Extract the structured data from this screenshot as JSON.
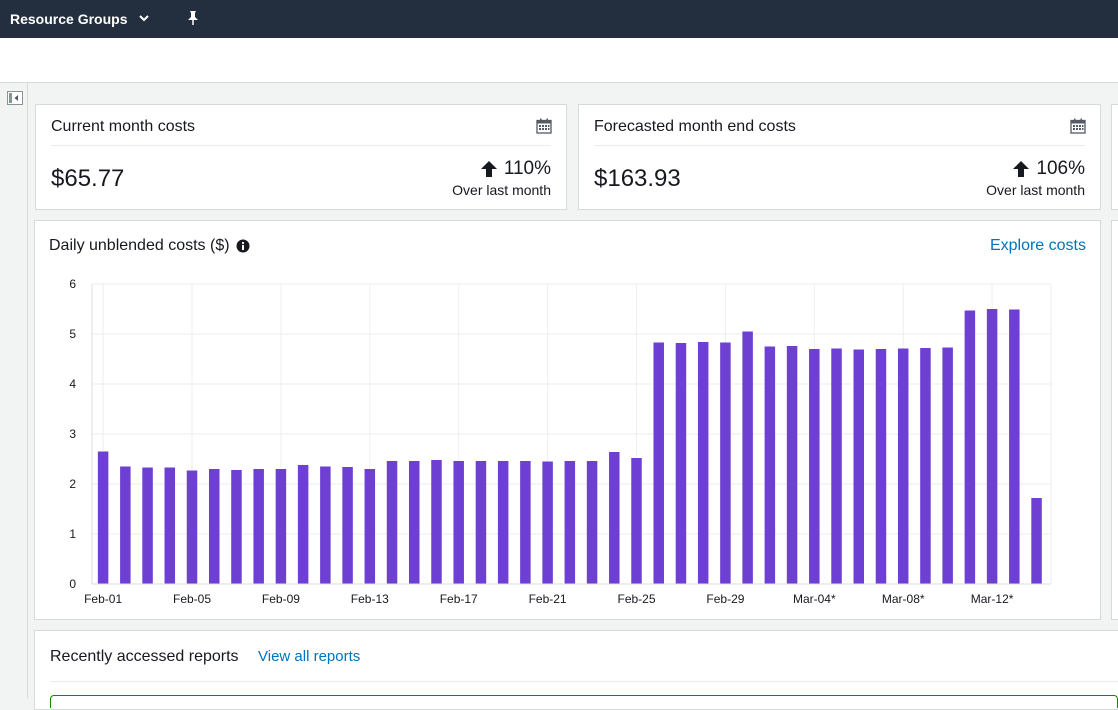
{
  "header": {
    "resource_groups_label": "Resource Groups",
    "icons": [
      "chevron-down-icon",
      "pin-icon"
    ],
    "bg_color": "#232f3e"
  },
  "cards": {
    "current": {
      "title": "Current month costs",
      "value": "$65.77",
      "change": "110%",
      "change_sub": "Over last month",
      "icon": "calendar-icon"
    },
    "forecast": {
      "title": "Forecasted month end costs",
      "value": "$163.93",
      "change": "106%",
      "change_sub": "Over last month",
      "icon": "calendar-icon"
    }
  },
  "daily_chart": {
    "title": "Daily unblended costs ($)",
    "explore_label": "Explore costs",
    "info_icon": "info-icon"
  },
  "chart_data": {
    "type": "bar",
    "title": "Daily unblended costs ($)",
    "xlabel": "",
    "ylabel": "",
    "ylim": [
      0,
      6
    ],
    "yticks": [
      0,
      1,
      2,
      3,
      4,
      5,
      6
    ],
    "grid": true,
    "bar_color": "#6e3fd3",
    "categories": [
      "Feb-01",
      "Feb-02",
      "Feb-03",
      "Feb-04",
      "Feb-05",
      "Feb-06",
      "Feb-07",
      "Feb-08",
      "Feb-09",
      "Feb-10",
      "Feb-11",
      "Feb-12",
      "Feb-13",
      "Feb-14",
      "Feb-15",
      "Feb-16",
      "Feb-17",
      "Feb-18",
      "Feb-19",
      "Feb-20",
      "Feb-21",
      "Feb-22",
      "Feb-23",
      "Feb-24",
      "Feb-25",
      "Feb-26",
      "Feb-27",
      "Feb-28",
      "Feb-29",
      "Mar-01",
      "Mar-02",
      "Mar-03",
      "Mar-04*",
      "Mar-05*",
      "Mar-06*",
      "Mar-07*",
      "Mar-08*",
      "Mar-09*",
      "Mar-10*",
      "Mar-11*",
      "Mar-12*",
      "Mar-13*",
      "Mar-14*"
    ],
    "tick_labels": [
      "Feb-01",
      "Feb-05",
      "Feb-09",
      "Feb-13",
      "Feb-17",
      "Feb-21",
      "Feb-25",
      "Feb-29",
      "Mar-04*",
      "Mar-08*",
      "Mar-12*"
    ],
    "values": [
      2.65,
      2.35,
      2.33,
      2.33,
      2.27,
      2.3,
      2.28,
      2.3,
      2.3,
      2.38,
      2.35,
      2.34,
      2.3,
      2.46,
      2.46,
      2.48,
      2.46,
      2.46,
      2.46,
      2.46,
      2.45,
      2.46,
      2.46,
      2.64,
      2.52,
      4.83,
      4.82,
      4.84,
      4.83,
      5.05,
      4.75,
      4.76,
      4.7,
      4.71,
      4.69,
      4.7,
      4.71,
      4.72,
      4.73,
      5.47,
      5.5,
      5.49,
      1.72
    ]
  },
  "reports": {
    "title": "Recently accessed reports",
    "view_all_label": "View all reports"
  }
}
